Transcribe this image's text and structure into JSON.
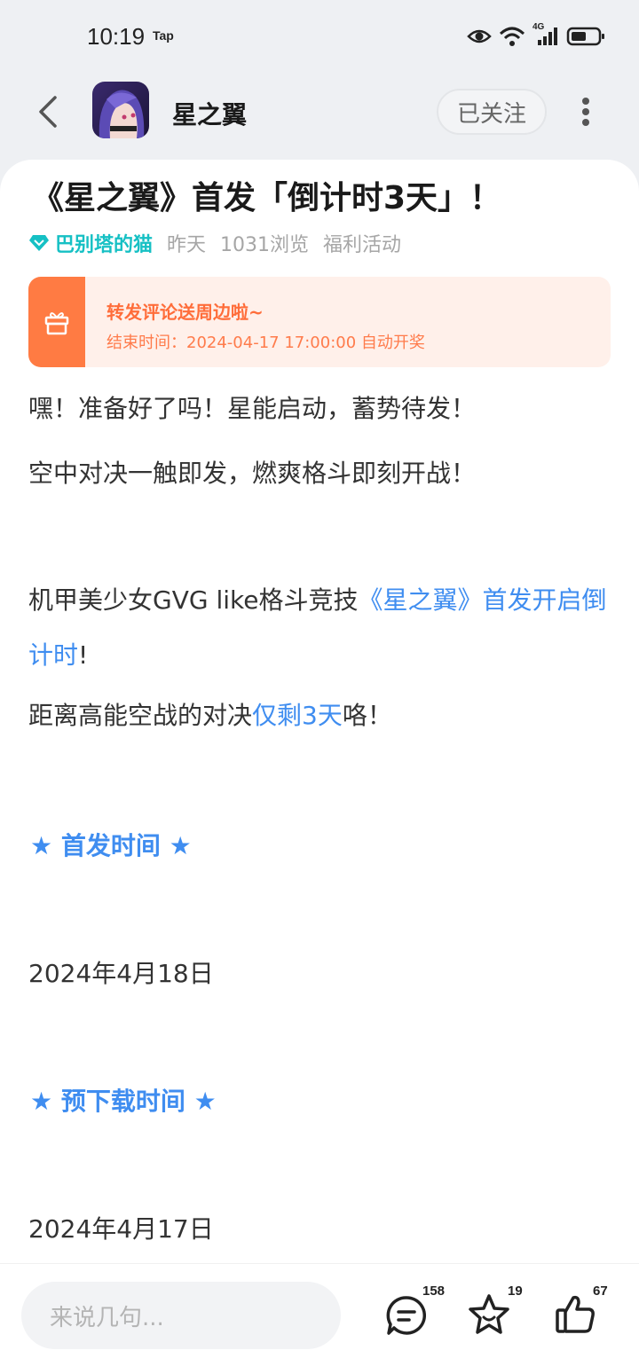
{
  "status_bar": {
    "time": "10:19",
    "carrier_tag": "Tap",
    "network": "4G"
  },
  "header": {
    "app_name": "星之翼",
    "follow_label": "已关注"
  },
  "post": {
    "title": "《星之翼》首发「倒计时3天」！",
    "author": "巴别塔的猫",
    "time": "昨天",
    "views": "1031浏览",
    "category": "福利活动"
  },
  "promo": {
    "title": "转发评论送周边啦~",
    "subtitle": "结束时间：2024-04-17 17:00:00 自动开奖"
  },
  "content": {
    "p1": "嘿！准备好了吗！星能启动，蓄势待发！",
    "p2": "空中对决一触即发，燃爽格斗即刻开战！",
    "p3_prefix": "机甲美少女GVG like格斗竞技",
    "p3_link": "《星之翼》首发开启倒计时",
    "p3_suffix": "!",
    "p4_prefix": "距离高能空战的对决",
    "p4_link": "仅剩3天",
    "p4_suffix": "咯！",
    "heading1": "★ 首发时间 ★",
    "date1": "2024年4月18日",
    "heading2": "★ 预下载时间 ★",
    "date2": "2024年4月17日"
  },
  "bottom_bar": {
    "input_placeholder": "来说几句...",
    "comment_count": "158",
    "favorite_count": "19",
    "like_count": "67"
  },
  "colors": {
    "accent_blue": "#3f8df0",
    "author_teal": "#16c0c4",
    "promo_orange": "#ff7b43"
  }
}
